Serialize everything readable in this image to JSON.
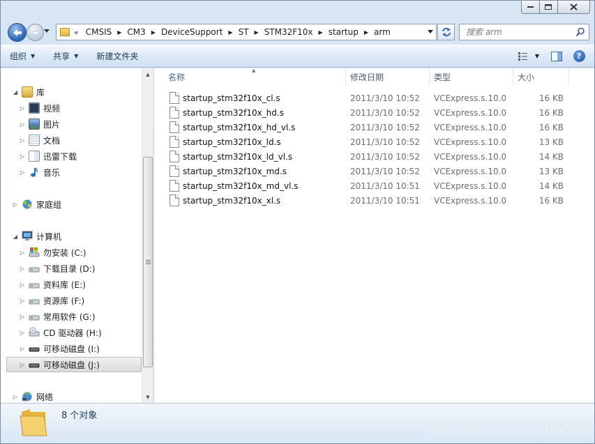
{
  "address": {
    "overflow": "«",
    "crumbs": [
      "CMSIS",
      "CM3",
      "DeviceSupport",
      "ST",
      "STM32F10x",
      "startup",
      "arm"
    ]
  },
  "search": {
    "placeholder": "搜索 arm"
  },
  "toolbar": {
    "organize": "组织",
    "share": "共享",
    "new_folder": "新建文件夹"
  },
  "nav": {
    "library": "库",
    "library_items": [
      "视频",
      "图片",
      "文档",
      "迅雷下载",
      "音乐"
    ],
    "homegroup": "家庭组",
    "computer": "计算机",
    "drives": [
      "勿安装 (C:)",
      "下载目录 (D:)",
      "资料库 (E:)",
      "资源库 (F:)",
      "常用软件 (G:)",
      "CD 驱动器 (H:)",
      "可移动磁盘 (I:)",
      "可移动磁盘 (J:)"
    ],
    "network": "网络"
  },
  "columns": {
    "name": "名称",
    "date": "修改日期",
    "type": "类型",
    "size": "大小"
  },
  "files": [
    {
      "name": "startup_stm32f10x_cl.s",
      "date": "2011/3/10 10:52",
      "type": "VCExpress.s.10.0",
      "size": "16 KB"
    },
    {
      "name": "startup_stm32f10x_hd.s",
      "date": "2011/3/10 10:52",
      "type": "VCExpress.s.10.0",
      "size": "16 KB"
    },
    {
      "name": "startup_stm32f10x_hd_vl.s",
      "date": "2011/3/10 10:52",
      "type": "VCExpress.s.10.0",
      "size": "16 KB"
    },
    {
      "name": "startup_stm32f10x_ld.s",
      "date": "2011/3/10 10:52",
      "type": "VCExpress.s.10.0",
      "size": "13 KB"
    },
    {
      "name": "startup_stm32f10x_ld_vl.s",
      "date": "2011/3/10 10:52",
      "type": "VCExpress.s.10.0",
      "size": "14 KB"
    },
    {
      "name": "startup_stm32f10x_md.s",
      "date": "2011/3/10 10:52",
      "type": "VCExpress.s.10.0",
      "size": "13 KB"
    },
    {
      "name": "startup_stm32f10x_md_vl.s",
      "date": "2011/3/10 10:51",
      "type": "VCExpress.s.10.0",
      "size": "14 KB"
    },
    {
      "name": "startup_stm32f10x_xl.s",
      "date": "2011/3/10 10:51",
      "type": "VCExpress.s.10.0",
      "size": "16 KB"
    }
  ],
  "status": {
    "count": "8 个对象"
  },
  "watermark": "https://blog.csdn.net/qq_41262681"
}
